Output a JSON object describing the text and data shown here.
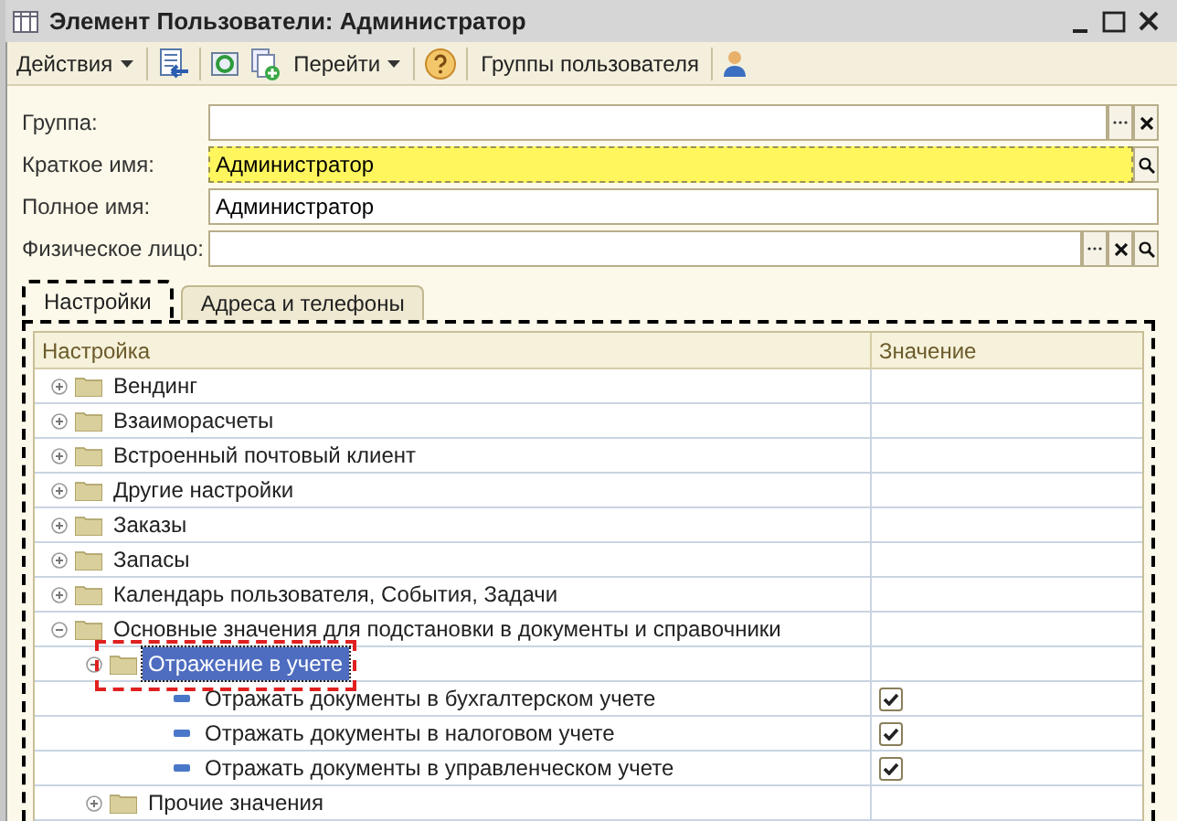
{
  "window": {
    "title": "Элемент Пользователи: Администратор"
  },
  "toolbar": [
    {
      "kind": "menu",
      "label": "Действия"
    },
    {
      "kind": "separator"
    },
    {
      "kind": "icon"
    },
    {
      "kind": "separator"
    },
    {
      "kind": "icon"
    },
    {
      "kind": "icon"
    },
    {
      "kind": "menu",
      "label": "Перейти"
    },
    {
      "kind": "separator"
    },
    {
      "kind": "icon"
    },
    {
      "kind": "separator"
    },
    {
      "kind": "button",
      "label": "Группы пользователя"
    },
    {
      "kind": "separator"
    },
    {
      "kind": "icon"
    }
  ],
  "fields": [
    {
      "label": "Группа:",
      "highlighted": false,
      "choose_button": true,
      "clear_button": true,
      "search_button": false
    },
    {
      "label": "Краткое имя:",
      "value": "Администратор",
      "highlighted": true,
      "choose_button": false,
      "clear_button": false,
      "search_button": true
    },
    {
      "label": "Полное имя:",
      "value": "Администратор",
      "highlighted": false,
      "choose_button": false,
      "clear_button": false,
      "search_button": false
    },
    {
      "label": "Физическое лицо:",
      "highlighted": false,
      "choose_button": true,
      "clear_button": true,
      "search_button": true
    }
  ],
  "tabs": [
    {
      "label": "Настройки",
      "selected": true
    },
    {
      "label": "Адреса и телефоны",
      "selected": false
    }
  ],
  "table": {
    "columns": [
      "Настройка",
      "Значение"
    ],
    "rows": [
      {
        "kind": "group",
        "label": "Вендинг",
        "expanded": false,
        "selected": false,
        "highlighted": false
      },
      {
        "kind": "group",
        "label": "Взаиморасчеты",
        "expanded": false,
        "selected": false,
        "highlighted": false
      },
      {
        "kind": "group",
        "label": "Встроенный почтовый клиент",
        "expanded": false,
        "selected": false,
        "highlighted": false
      },
      {
        "kind": "group",
        "label": "Другие настройки",
        "expanded": false,
        "selected": false,
        "highlighted": false
      },
      {
        "kind": "group",
        "label": "Заказы",
        "expanded": false,
        "selected": false,
        "highlighted": false
      },
      {
        "kind": "group",
        "label": "Запасы",
        "expanded": false,
        "selected": false,
        "highlighted": false
      },
      {
        "kind": "group",
        "label": "Календарь пользователя, События, Задачи",
        "expanded": false,
        "selected": false,
        "highlighted": false
      },
      {
        "kind": "group",
        "label": "Основные значения для подстановки в документы и справочники",
        "expanded": true,
        "selected": false,
        "highlighted": false,
        "children": [
          {
            "kind": "group",
            "label": "Отражение в учете",
            "expanded": true,
            "selected": true,
            "highlighted": true,
            "children": [
              {
                "kind": "setting",
                "label": "Отражать документы в бухгалтерском учете",
                "checked": true,
                "selected": false
              },
              {
                "kind": "setting",
                "label": "Отражать документы в налоговом учете",
                "checked": true,
                "selected": false
              },
              {
                "kind": "setting",
                "label": "Отражать документы в управленческом учете",
                "checked": true,
                "selected": false
              }
            ]
          },
          {
            "kind": "group",
            "label": "Прочие значения",
            "expanded": false,
            "selected": false,
            "highlighted": false
          }
        ]
      }
    ]
  }
}
